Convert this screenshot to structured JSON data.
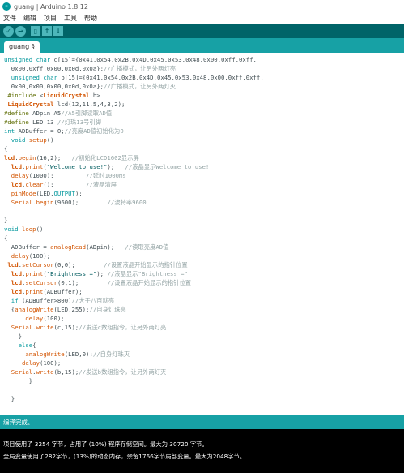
{
  "window": {
    "title": "guang | Arduino 1.8.12",
    "icon_text": "∞"
  },
  "menu": [
    "文件",
    "编辑",
    "项目",
    "工具",
    "帮助"
  ],
  "toolbar": {
    "verify": "✓",
    "upload": "→",
    "new": "▯",
    "open": "↑",
    "save": "↓"
  },
  "tab": {
    "label": "guang §"
  },
  "colors": {
    "toolbar_bg": "#006468",
    "tab_strip_bg": "#17a1a5",
    "status_bg": "#17a1a5",
    "console_bg": "#000000"
  },
  "code": {
    "l1": "unsigned char c[15]={0x41,0x54,0x2B,0x4D,0x45,0x53,0x48,0x00,0xff,0xff,",
    "l2": "  0x00,0xff,0x00,0x0d,0x0a};//广播模式，让另外两灯亮",
    "l3": "  unsigned char b[15]={0x41,0x54,0x2B,0x4D,0x45,0x53,0x48,0x00,0xff,0xff,",
    "l4": "  0x00,0x00,0x00,0x0d,0x0a};//广播模式，让另外两灯灭",
    "l5": " #include <LiquidCrystal.h>",
    "l6": " LiquidCrystal lcd(12,11,5,4,3,2);",
    "l7": "#define ADpin A5//A5引脚读取AD值",
    "l8": "#define LED 13 //灯珠13号引脚",
    "l9": "int ADBuffer = 0;//亮度AD值初始化为0",
    "l10": "  void setup()",
    "l11": "{",
    "l12": "lcd.begin(16,2);   //初始化LCD1602显示屏",
    "l13": "  lcd.print(\"Welcome to use!\");   //液晶显示Welcome to use!",
    "l14": "  delay(1000);         //延时1000ms",
    "l15": "  lcd.clear();         //液晶清屏",
    "l16": "  pinMode(LED,OUTPUT);",
    "l17": "  Serial.begin(9600);        //波特率9600",
    "l18": "",
    "l19": "}",
    "l20": "void loop()",
    "l21": "{",
    "l22": "  ADBuffer = analogRead(ADpin);   //读取亮度AD值",
    "l23": "  delay(100);",
    "l24": " lcd.setCursor(0,0);        //设置液晶开始显示的指针位置",
    "l25": "  lcd.print(\"Brightness =\"); //液晶显示\"Brightness =\"",
    "l26": "  lcd.setCursor(0,1);        //设置液晶开始显示的指针位置",
    "l27": "  lcd.print(ADBuffer);",
    "l28": "  if (ADBuffer>800)//大于八百就亮",
    "l29": "  {analogWrite(LED,255);//自身灯珠亮",
    "l30": "      delay(100);",
    "l31": "  Serial.write(c,15);//发送c数组指令，让另外两灯亮",
    "l32": "    }",
    "l33": "    else{",
    "l34": "      analogWrite(LED,0);//自身灯珠灭",
    "l35": "     delay(100);",
    "l36": "  Serial.write(b,15);//发送b数组指令，让另外两灯灭",
    "l37": "       }",
    "l38": "",
    "l39": "  }"
  },
  "status": {
    "message": "编译完成。"
  },
  "console": {
    "line1": "项目使用了 3254 字节，占用了 (10%) 程序存储空间。最大为 30720 字节。",
    "line2": "全局变量使用了282字节，(13%)的动态内存，余留1766字节局部变量。最大为2048字节。"
  }
}
